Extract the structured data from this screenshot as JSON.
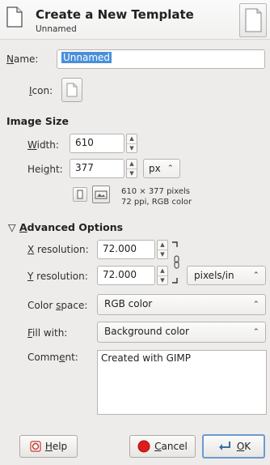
{
  "header": {
    "title": "Create a New Template",
    "subtitle": "Unnamed"
  },
  "name": {
    "label_pre": "",
    "label_u": "N",
    "label_post": "ame:",
    "value": "Unnamed"
  },
  "icon": {
    "label_pre": "",
    "label_u": "I",
    "label_post": "con:"
  },
  "image_size": {
    "heading": "Image Size",
    "width": {
      "label_pre": "",
      "label_u": "W",
      "label_post": "idth:",
      "value": "610"
    },
    "height": {
      "label_pre": "Hei",
      "label_u": "g",
      "label_post": "ht:",
      "value": "377"
    },
    "unit": "px",
    "info_line1": "610 × 377 pixels",
    "info_line2": "72 ppi, RGB color"
  },
  "advanced": {
    "heading_u": "A",
    "heading_rest": "dvanced Options",
    "xres": {
      "label_u": "X",
      "label_post": " resolution:",
      "value": "72.000"
    },
    "yres": {
      "label_u": "Y",
      "label_post": " resolution:",
      "value": "72.000"
    },
    "res_unit": "pixels/in",
    "color_space": {
      "label_pre": "Color ",
      "label_u": "s",
      "label_post": "pace:",
      "value": "RGB color"
    },
    "fill": {
      "label_u": "F",
      "label_post": "ill with:",
      "value": "Background color"
    },
    "comment": {
      "label_pre": "Comm",
      "label_u": "e",
      "label_post": "nt:",
      "value": "Created with GIMP"
    }
  },
  "buttons": {
    "help_u": "H",
    "help_rest": "elp",
    "cancel_u": "C",
    "cancel_rest": "ancel",
    "ok_u": "O",
    "ok_rest": "K"
  }
}
